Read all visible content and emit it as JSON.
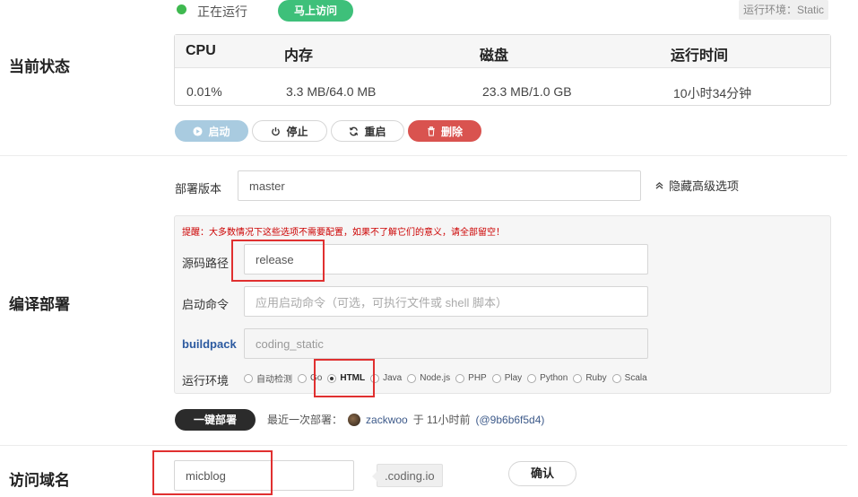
{
  "status": {
    "section_label": "当前状态",
    "running_text": "正在运行",
    "visit_button": "马上访问",
    "env_badge": "运行环境：Static"
  },
  "stats": {
    "headers": [
      "CPU",
      "内存",
      "磁盘",
      "运行时间"
    ],
    "values": [
      "0.01%",
      "3.3 MB/64.0 MB",
      "23.3 MB/1.0 GB",
      "10小时34分钟"
    ]
  },
  "controls": {
    "start": "启动",
    "stop": "停止",
    "restart": "重启",
    "delete": "删除"
  },
  "build": {
    "section_label": "编译部署",
    "deploy_version_label": "部署版本",
    "deploy_version_value": "master",
    "toggle_advanced": "隐藏高级选项",
    "warning": "提醒：大多数情况下这些选项不需要配置，如果不了解它们的意义，请全部留空！",
    "source_path_label": "源码路径",
    "source_path_value": "release",
    "start_cmd_label": "启动命令",
    "start_cmd_placeholder": "应用启动命令（可选，可执行文件或 shell 脚本）",
    "buildpack_label": "buildpack",
    "buildpack_value": "coding_static",
    "runtime_label": "运行环境",
    "runtimes": [
      "自动检测",
      "Go",
      "HTML",
      "Java",
      "Node.js",
      "PHP",
      "Play",
      "Python",
      "Ruby",
      "Scala"
    ],
    "runtime_selected": "HTML",
    "deploy_button": "一键部署",
    "last_deploy_prefix": "最近一次部署：",
    "last_deploy_user": "zackwoo",
    "last_deploy_time": "于 11小时前",
    "last_deploy_commit": "(@9b6b6f5d4)"
  },
  "domain": {
    "section_label": "访问域名",
    "value": "micblog",
    "suffix": ".coding.io",
    "confirm": "确认"
  },
  "colors": {
    "running_green": "#3fb950",
    "visit_button": "#3ec07a",
    "delete_red": "#d9534f",
    "highlight_red": "#e03030",
    "buildpack_blue": "#2c5aa0"
  }
}
